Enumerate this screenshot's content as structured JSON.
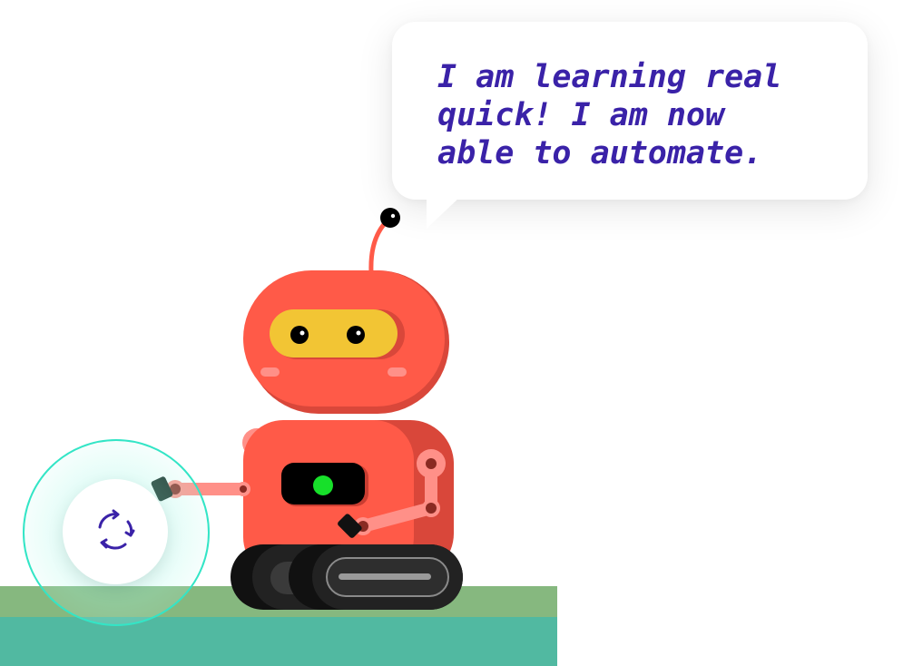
{
  "speech_bubble": {
    "text": "I am learning real\nquick! I am now\nable to automate."
  },
  "icons": {
    "badge_icon": "refresh-cycle-icon"
  },
  "colors": {
    "text": "#3a22a8",
    "robot_body": "#ff5a48",
    "robot_shade": "#d9473a",
    "visor": "#f2c534",
    "indicator": "#17e02a",
    "grass": "#86b87f",
    "water": "#51b9a1",
    "badge_ring": "#33e5c6",
    "badge_icon": "#3a22a8"
  }
}
